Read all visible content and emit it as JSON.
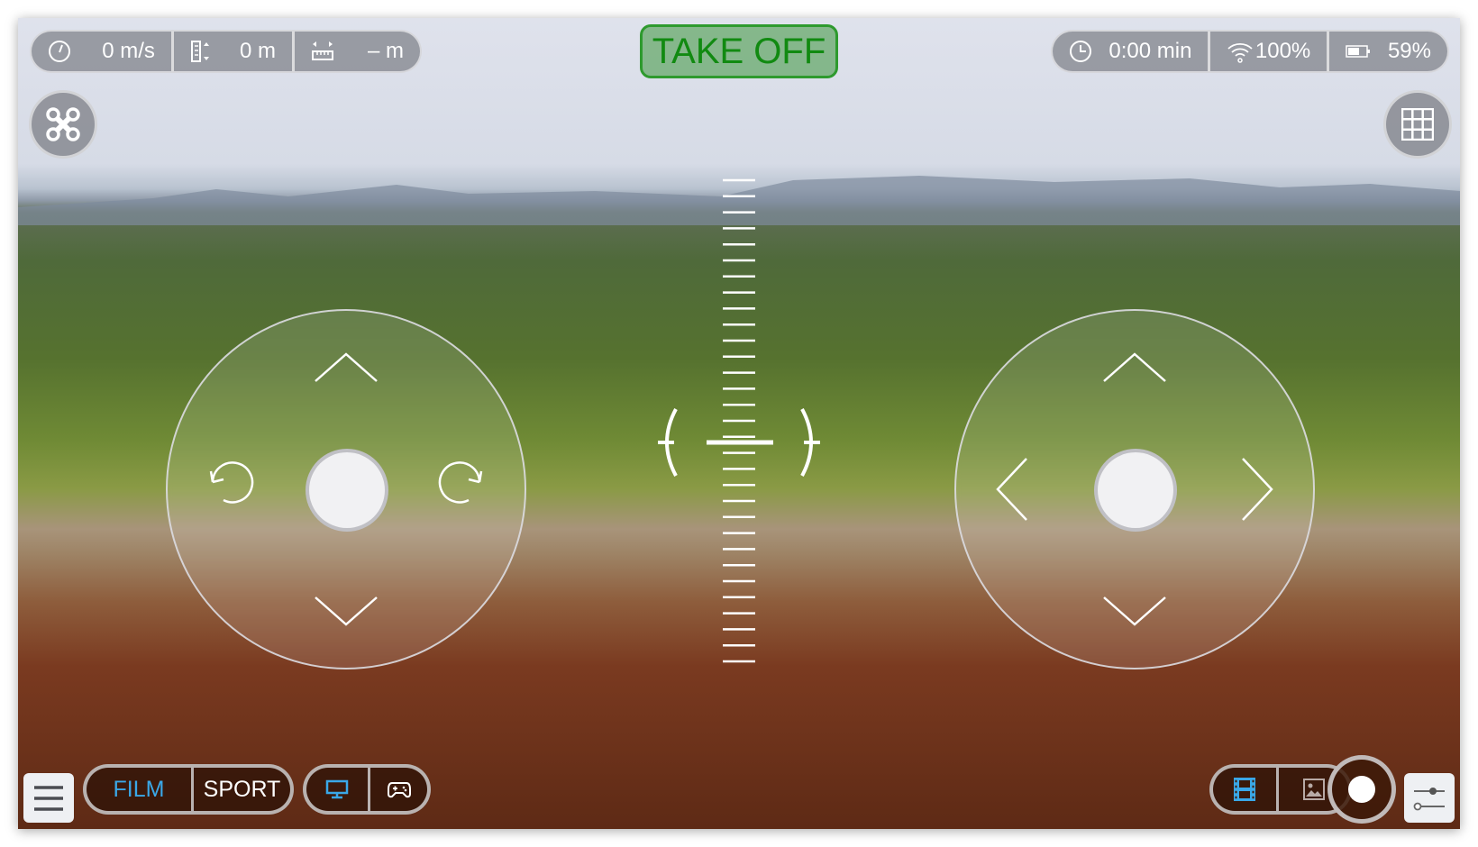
{
  "telemetry_left": {
    "speed": {
      "icon": "speedometer-icon",
      "value": "0 m/s"
    },
    "altitude": {
      "icon": "altitude-icon",
      "value": "0 m"
    },
    "distance": {
      "icon": "distance-icon",
      "value": "– m"
    }
  },
  "telemetry_right": {
    "flight_time": {
      "icon": "clock-icon",
      "value": "0:00 min"
    },
    "signal": {
      "icon": "wifi-icon",
      "value": "100%"
    },
    "battery": {
      "icon": "battery-icon",
      "value": "59%",
      "level_percent": 59
    }
  },
  "takeoff": {
    "label": "TAKE OFF",
    "color": "#118a11"
  },
  "modes": {
    "film": "FILM",
    "sport": "SPORT",
    "active": "FILM",
    "accent": "#3aa8e8"
  },
  "view_toggle": {
    "active": "display"
  },
  "media": {
    "active": "video"
  }
}
